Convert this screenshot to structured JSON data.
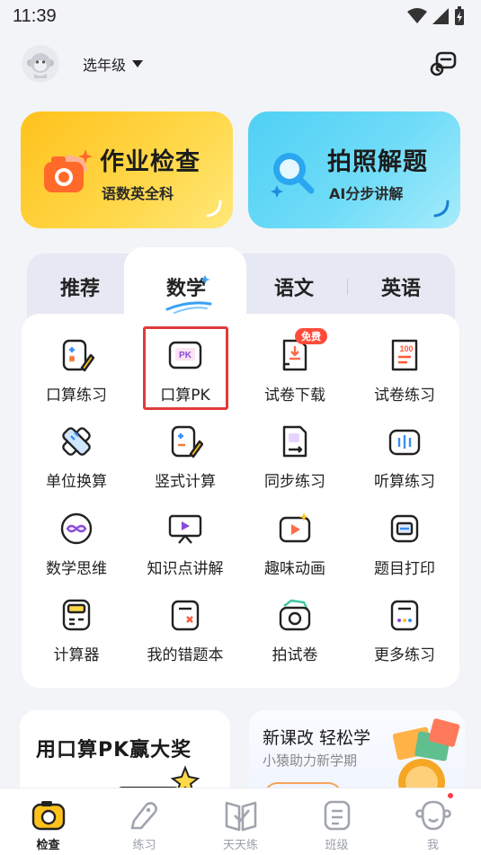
{
  "status_bar": {
    "time": "11:39",
    "icons": [
      "wifi-icon",
      "signal-icon",
      "battery-charging-icon"
    ]
  },
  "header": {
    "grade_select": "选年级",
    "avatar_icon": "monkey-avatar-icon",
    "right_icon": "headset-chat-icon"
  },
  "hero_cards": [
    {
      "title": "作业检查",
      "subtitle": "语数英全科",
      "icon": "camera-icon",
      "color": "#ffc21c"
    },
    {
      "title": "拍照解题",
      "subtitle": "AI分步讲解",
      "icon": "magnifier-icon",
      "color": "#4fd0f4"
    }
  ],
  "subject_tabs": [
    {
      "label": "推荐"
    },
    {
      "label": "数学",
      "active": true
    },
    {
      "label": "语文"
    },
    {
      "label": "英语"
    }
  ],
  "grid": {
    "items": [
      {
        "label": "口算练习",
        "icon": "calc-practice-icon"
      },
      {
        "label": "口算PK",
        "icon": "pk-icon",
        "highlighted": true
      },
      {
        "label": "试卷下载",
        "icon": "paper-download-icon",
        "badge": "免费"
      },
      {
        "label": "试卷练习",
        "icon": "paper-score-icon"
      },
      {
        "label": "单位换算",
        "icon": "ruler-icon"
      },
      {
        "label": "竖式计算",
        "icon": "vertical-calc-icon"
      },
      {
        "label": "同步练习",
        "icon": "sync-practice-icon"
      },
      {
        "label": "听算练习",
        "icon": "listen-calc-icon"
      },
      {
        "label": "数学思维",
        "icon": "infinity-icon"
      },
      {
        "label": "知识点讲解",
        "icon": "video-lecture-icon"
      },
      {
        "label": "趣味动画",
        "icon": "animation-icon"
      },
      {
        "label": "题目打印",
        "icon": "printer-icon"
      },
      {
        "label": "计算器",
        "icon": "calculator-icon"
      },
      {
        "label": "我的错题本",
        "icon": "mistake-book-icon"
      },
      {
        "label": "拍试卷",
        "icon": "camera-paper-icon"
      },
      {
        "label": "更多练习",
        "icon": "more-practice-icon"
      }
    ],
    "badge_text": "免费"
  },
  "promos": {
    "left_title": "用口算PK赢大奖",
    "right_title": "新课改 轻松学",
    "right_subtitle": "小猿助力新学期"
  },
  "bottom_nav": [
    {
      "label": "检查",
      "icon": "camera-icon",
      "active": true
    },
    {
      "label": "练习",
      "icon": "pencil-tag-icon"
    },
    {
      "label": "天天练",
      "icon": "check-book-icon"
    },
    {
      "label": "班级",
      "icon": "class-list-icon"
    },
    {
      "label": "我",
      "icon": "profile-face-icon"
    }
  ],
  "colors": {
    "accent_yellow": "#ffc21c",
    "accent_cyan": "#4fd0f4",
    "highlight_red": "#e03b3b",
    "badge_red": "#ff4b3a"
  }
}
